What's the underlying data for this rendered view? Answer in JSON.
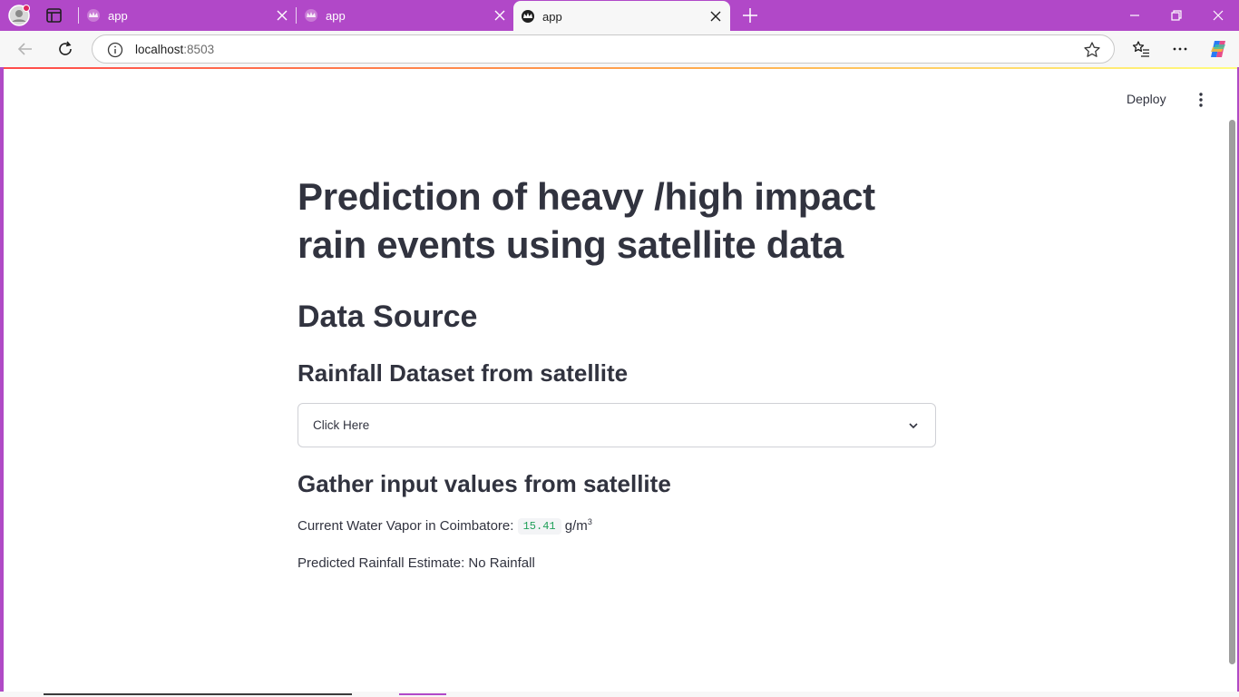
{
  "browser": {
    "tabs": [
      {
        "title": "app",
        "active": false
      },
      {
        "title": "app",
        "active": false
      },
      {
        "title": "app",
        "active": true
      }
    ],
    "url_host": "localhost",
    "url_port": ":8503",
    "accent_color": "#b148c8"
  },
  "app_header": {
    "deploy_label": "Deploy"
  },
  "main": {
    "title": "Prediction of heavy /high impact rain events using satellite data",
    "data_source_heading": "Data Source",
    "dataset_subheading": "Rainfall Dataset from satellite",
    "expander_label": "Click Here",
    "inputs_subheading": "Gather input values from satellite",
    "water_vapor_label": "Current Water Vapor in Coimbatore:",
    "water_vapor_value": "15.41",
    "water_vapor_unit": "g/m",
    "water_vapor_unit_sup": "3",
    "prediction_text": "Predicted Rainfall Estimate: No Rainfall"
  }
}
